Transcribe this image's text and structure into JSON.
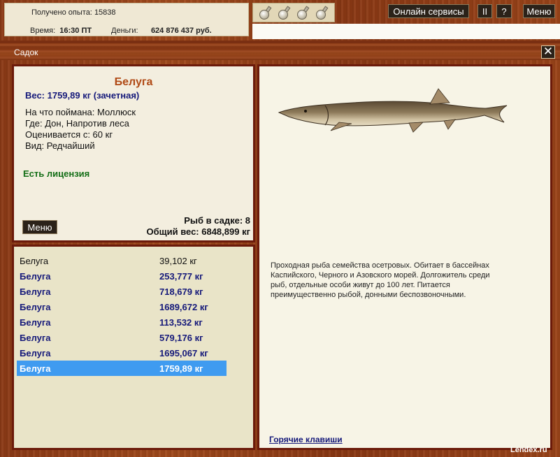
{
  "status": {
    "exp_label": "Получено опыта:",
    "exp_value": "15838",
    "time_label": "Время:",
    "time_value": "16:30 ПТ",
    "money_label": "Деньги:",
    "money_value": "624 876 437 руб."
  },
  "toolbar": {
    "online_label": "Онлайн сервисы",
    "pause_label": "II",
    "help_label": "?",
    "menu_label": "Меню",
    "flask_icons": [
      "flask-icon",
      "flask-icon",
      "flask-icon",
      "flask-icon"
    ]
  },
  "window": {
    "title": "Садок",
    "close_label": "✕"
  },
  "fish": {
    "name": "Белуга",
    "weight": "Вес: 1759,89 кг (зачетная)",
    "bait": "На что поймана: Моллюск",
    "location": "Где: Дон, Напротив леса",
    "valued": "Оценивается с: 60 кг",
    "kind": "Вид: Редчайший",
    "license": "Есть лицензия",
    "menu_label": "Меню",
    "count": "Рыб в садке: 8",
    "total": "Общий вес: 6848,899 кг"
  },
  "catches": [
    {
      "name": "Белуга",
      "weight": "39,102 кг"
    },
    {
      "name": "Белуга",
      "weight": "253,777 кг"
    },
    {
      "name": "Белуга",
      "weight": "718,679 кг"
    },
    {
      "name": "Белуга",
      "weight": "1689,672 кг"
    },
    {
      "name": "Белуга",
      "weight": "113,532 кг"
    },
    {
      "name": "Белуга",
      "weight": "579,176 кг"
    },
    {
      "name": "Белуга",
      "weight": "1695,067 кг"
    },
    {
      "name": "Белуга",
      "weight": "1759,89 кг"
    }
  ],
  "description": "Проходная рыба семейства осетровых. Обитает в бассейнах Каспийского, Черного и Азовского морей. Долгожитель среди рыб, отдельные особи живут до 100 лет. Питается преимущественно рыбой, донными беспозвоночными.",
  "hotkeys": "Горячие клавиши",
  "watermark": "Lendex.ru",
  "colors": {
    "title": "#b04a16",
    "accent": "#15197a",
    "license": "#136e16",
    "selected": "#3f9bf0"
  }
}
